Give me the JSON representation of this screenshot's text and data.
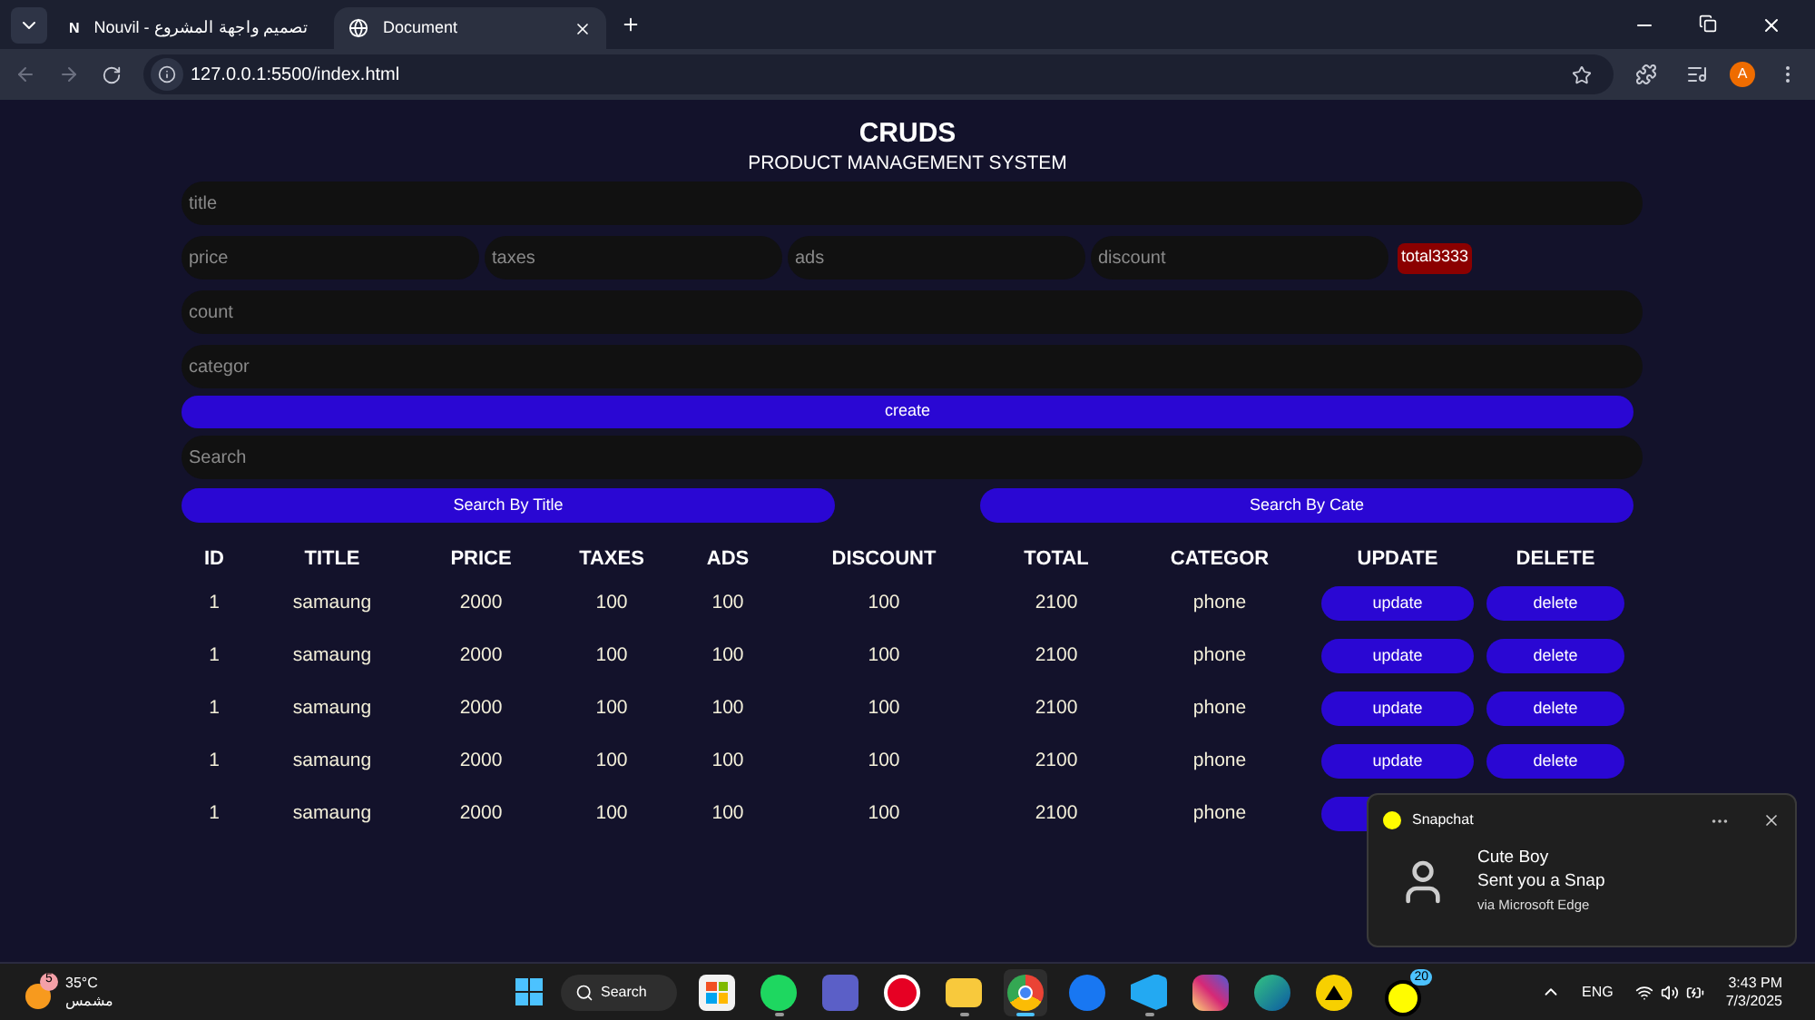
{
  "browser": {
    "tabs": [
      {
        "favicon_letter": "N",
        "title": "تصميم واجهة المشروع - Nouvil",
        "selected": false
      },
      {
        "title": "Document",
        "selected": true
      }
    ],
    "url": "127.0.0.1:5500/index.html",
    "profile_letter": "A"
  },
  "page": {
    "title": "CRUDS",
    "subtitle": "PRODUCT MANAGEMENT SYSTEM",
    "title_field": {
      "placeholder": "title"
    },
    "price_fields": [
      {
        "placeholder": "price"
      },
      {
        "placeholder": "taxes"
      },
      {
        "placeholder": "ads"
      },
      {
        "placeholder": "discount"
      }
    ],
    "total": "total3333",
    "count_field": {
      "placeholder": "count"
    },
    "category_field": {
      "placeholder": "categor"
    },
    "create_button": "create",
    "search_field": {
      "placeholder": "Search"
    },
    "search_buttons": [
      "Search By Title",
      "Search By Cate"
    ],
    "table": {
      "columns": [
        "ID",
        "TITLE",
        "PRICE",
        "TAXES",
        "ADS",
        "DISCOUNT",
        "TOTAL",
        "CATEGOR",
        "UPDATE",
        "DELETE"
      ],
      "rows": [
        {
          "cells": [
            "1",
            "samaung",
            "2000",
            "100",
            "100",
            "100",
            "2100",
            "phone"
          ],
          "update": "update",
          "delete": "delete"
        },
        {
          "cells": [
            "1",
            "samaung",
            "2000",
            "100",
            "100",
            "100",
            "2100",
            "phone"
          ],
          "update": "update",
          "delete": "delete"
        },
        {
          "cells": [
            "1",
            "samaung",
            "2000",
            "100",
            "100",
            "100",
            "2100",
            "phone"
          ],
          "update": "update",
          "delete": "delete"
        },
        {
          "cells": [
            "1",
            "samaung",
            "2000",
            "100",
            "100",
            "100",
            "2100",
            "phone"
          ],
          "update": "update",
          "delete": "delete"
        },
        {
          "cells": [
            "1",
            "samaung",
            "2000",
            "100",
            "100",
            "100",
            "2100",
            "phone"
          ]
        }
      ]
    }
  },
  "notification": {
    "app": "Snapchat",
    "sender": "Cute Boy",
    "message": "Sent you a Snap",
    "source": "via Microsoft Edge"
  },
  "taskbar": {
    "weather": {
      "badge": "5",
      "temperature": "35°C",
      "condition": "مشمس"
    },
    "search": "Search",
    "apps": [
      {
        "kind": "store",
        "running": false,
        "selected": false
      },
      {
        "kind": "spotify",
        "running": true,
        "selected": false
      },
      {
        "kind": "teams",
        "running": false,
        "selected": false
      },
      {
        "kind": "pinterest",
        "running": false,
        "selected": false
      },
      {
        "kind": "folder",
        "running": true,
        "selected": false
      },
      {
        "kind": "chrome",
        "running": true,
        "selected": true
      },
      {
        "kind": "facebook",
        "running": false,
        "selected": false
      },
      {
        "kind": "vscode",
        "running": true,
        "selected": false
      },
      {
        "kind": "instagram",
        "running": false,
        "selected": false
      },
      {
        "kind": "edge",
        "running": false,
        "selected": false
      },
      {
        "kind": "triangle",
        "running": false,
        "selected": false
      },
      {
        "kind": "snapchat",
        "running": false,
        "selected": false,
        "badge": "20"
      }
    ],
    "language": "ENG",
    "time": "3:43 PM",
    "date": "7/3/2025"
  }
}
